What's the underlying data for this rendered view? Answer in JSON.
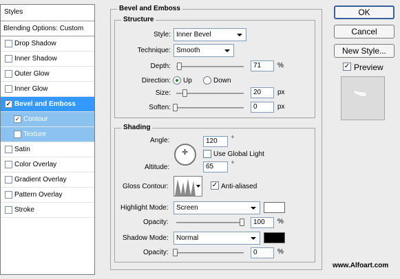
{
  "styles_panel": {
    "header": "Styles",
    "blending_options": "Blending Options: Custom",
    "items": [
      {
        "label": "Drop Shadow",
        "checked": false
      },
      {
        "label": "Inner Shadow",
        "checked": false
      },
      {
        "label": "Outer Glow",
        "checked": false
      },
      {
        "label": "Inner Glow",
        "checked": false
      },
      {
        "label": "Bevel and Emboss",
        "checked": true
      },
      {
        "label": "Contour",
        "checked": true
      },
      {
        "label": "Texture",
        "checked": false
      },
      {
        "label": "Satin",
        "checked": false
      },
      {
        "label": "Color Overlay",
        "checked": false
      },
      {
        "label": "Gradient Overlay",
        "checked": false
      },
      {
        "label": "Pattern Overlay",
        "checked": false
      },
      {
        "label": "Stroke",
        "checked": false
      }
    ]
  },
  "bevel": {
    "title": "Bevel and Emboss",
    "structure": {
      "title": "Structure",
      "style_label": "Style:",
      "style_value": "Inner Bevel",
      "technique_label": "Technique:",
      "technique_value": "Smooth",
      "depth_label": "Depth:",
      "depth_value": "71",
      "depth_unit": "%",
      "direction_label": "Direction:",
      "direction_up": "Up",
      "direction_down": "Down",
      "direction_selected": "Up",
      "size_label": "Size:",
      "size_value": "20",
      "size_unit": "px",
      "soften_label": "Soften:",
      "soften_value": "0",
      "soften_unit": "px"
    },
    "shading": {
      "title": "Shading",
      "angle_label": "Angle:",
      "angle_value": "120",
      "angle_unit": "°",
      "global_light_label": "Use Global Light",
      "global_light_checked": false,
      "altitude_label": "Altitude:",
      "altitude_value": "65",
      "altitude_unit": "°",
      "gloss_contour_label": "Gloss Contour:",
      "anti_aliased_label": "Anti-aliased",
      "anti_aliased_checked": true,
      "highlight_mode_label": "Highlight Mode:",
      "highlight_mode_value": "Screen",
      "highlight_color": "#ffffff",
      "highlight_opacity_label": "Opacity:",
      "highlight_opacity_value": "100",
      "highlight_opacity_unit": "%",
      "shadow_mode_label": "Shadow Mode:",
      "shadow_mode_value": "Normal",
      "shadow_color": "#000000",
      "shadow_opacity_label": "Opacity:",
      "shadow_opacity_value": "0",
      "shadow_opacity_unit": "%"
    }
  },
  "buttons": {
    "ok": "OK",
    "cancel": "Cancel",
    "new_style": "New Style...",
    "preview_label": "Preview",
    "preview_checked": true
  },
  "watermark": "www.Alfoart.com",
  "colors": {
    "selected_bg": "#3399ff",
    "subitem_bg": "#8cc2f0"
  }
}
